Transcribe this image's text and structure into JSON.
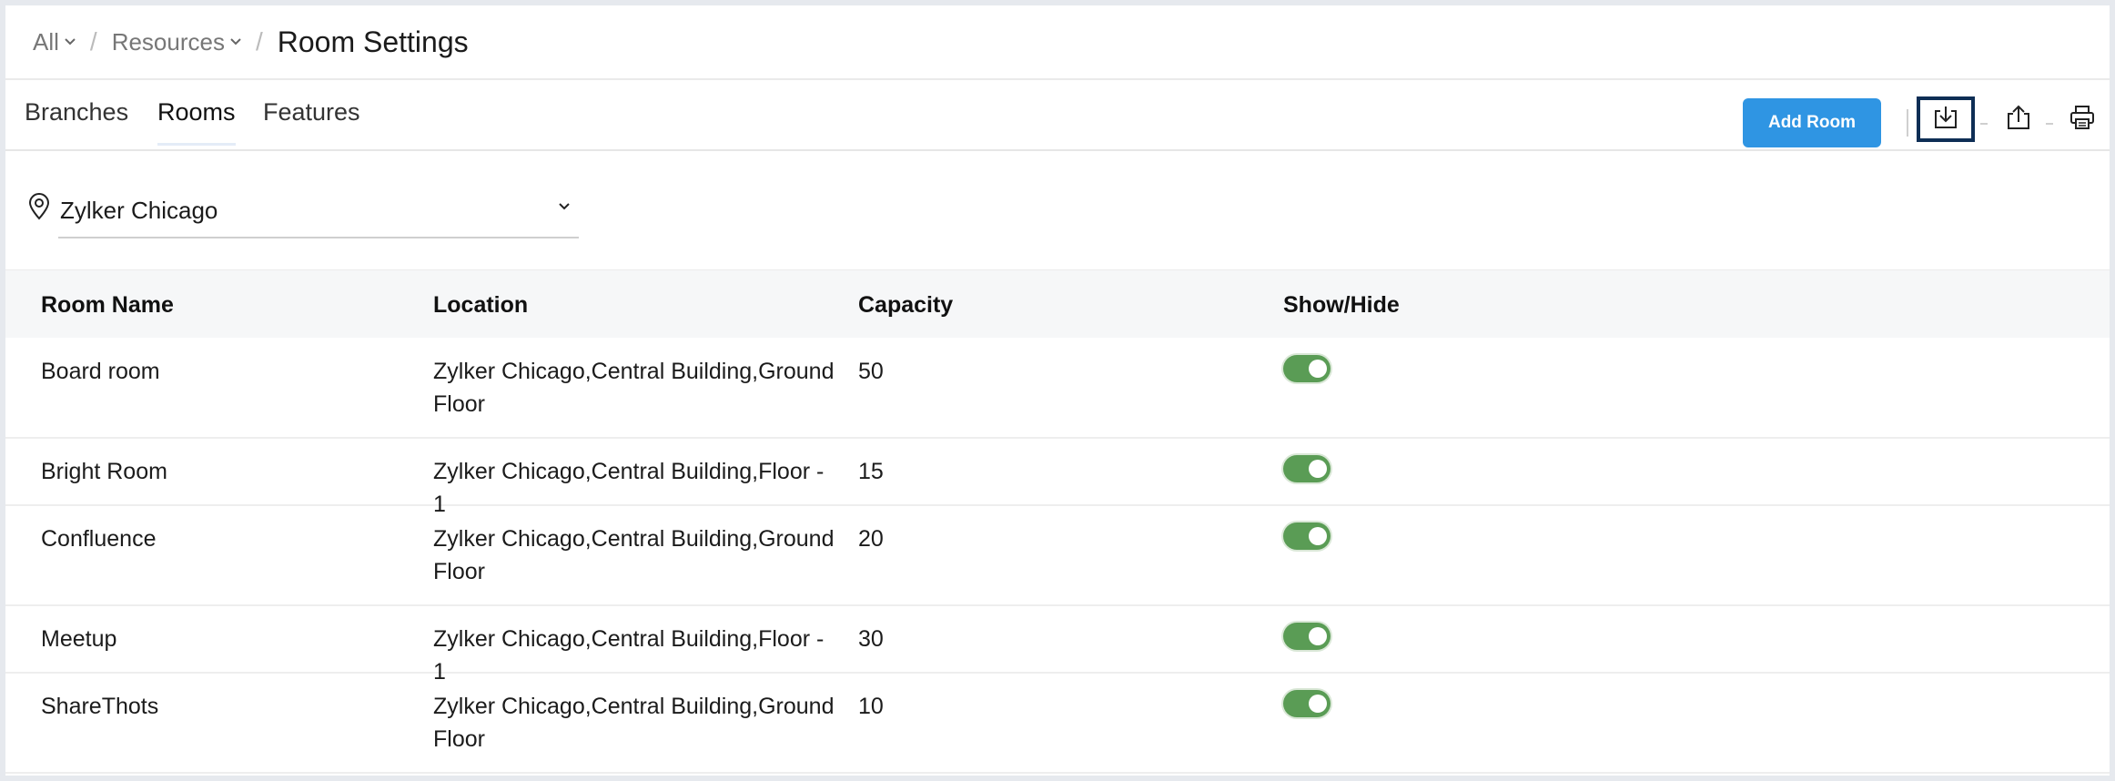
{
  "breadcrumb": {
    "all_label": "All",
    "resources_label": "Resources",
    "separator": "/",
    "current": "Room Settings"
  },
  "tabs": [
    {
      "label": "Branches"
    },
    {
      "label": "Rooms",
      "active": true
    },
    {
      "label": "Features"
    }
  ],
  "toolbar": {
    "add_room_label": "Add Room",
    "icons": [
      "import-icon",
      "export-icon",
      "print-icon"
    ],
    "accent_color": "#2f95e3"
  },
  "location_selector": {
    "value": "Zylker Chicago",
    "icon": "location-pin-icon"
  },
  "table": {
    "columns": [
      "Room Name",
      "Location",
      "Capacity",
      "Show/Hide"
    ],
    "rows": [
      {
        "name": "Board room",
        "location": "Zylker Chicago,Central Building,Ground Floor",
        "capacity": "50",
        "visible": true
      },
      {
        "name": "Bright Room",
        "location": "Zylker Chicago,Central Building,Floor - 1",
        "capacity": "15",
        "visible": true
      },
      {
        "name": "Confluence",
        "location": "Zylker Chicago,Central Building,Ground Floor",
        "capacity": "20",
        "visible": true
      },
      {
        "name": "Meetup",
        "location": "Zylker Chicago,Central Building,Floor - 1",
        "capacity": "30",
        "visible": true
      },
      {
        "name": "ShareThots",
        "location": "Zylker Chicago,Central Building,Ground Floor",
        "capacity": "10",
        "visible": true
      }
    ],
    "toggle_on_color": "#5a9c55"
  }
}
